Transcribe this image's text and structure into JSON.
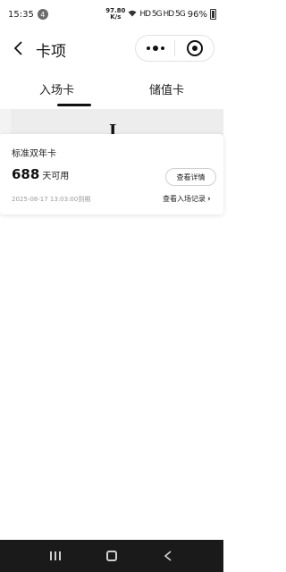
{
  "status_bar": {
    "time": "15:35",
    "notification_count": "4",
    "net_speed_value": "97.80",
    "net_speed_unit": "K/s",
    "signal_text": "HD 5G HD 5G",
    "battery": "96%"
  },
  "nav": {
    "title": "卡项"
  },
  "tabs": [
    {
      "label": "入场卡",
      "active": true
    },
    {
      "label": "储值卡",
      "active": false
    }
  ],
  "card": {
    "name": "标准双年卡",
    "days_value": "688",
    "days_unit": "天可用",
    "expiry": "2025-08-17 13:03:00到期",
    "detail_button": "查看详情",
    "record_link": "查看入场记录"
  },
  "icons": {
    "back": "chevron-left-icon",
    "more": "more-dots-icon",
    "close": "target-circle-icon",
    "record_chevron": "chevron-right-icon"
  },
  "colors": {
    "text_primary": "#111111",
    "text_secondary": "#9a9a9a",
    "tab_indicator": "#111111",
    "system_nav_bg": "#1a1a1a"
  }
}
